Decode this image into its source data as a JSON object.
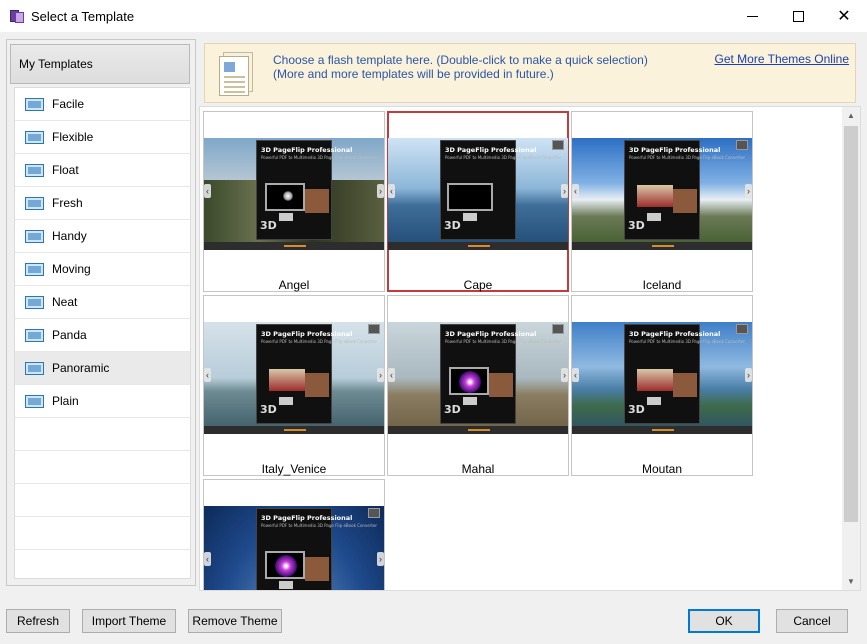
{
  "window": {
    "title": "Select a Template"
  },
  "left_panel": {
    "header": "My Templates",
    "items": [
      {
        "label": "Facile"
      },
      {
        "label": "Flexible"
      },
      {
        "label": "Float"
      },
      {
        "label": "Fresh"
      },
      {
        "label": "Handy"
      },
      {
        "label": "Moving"
      },
      {
        "label": "Neat"
      },
      {
        "label": "Panda"
      },
      {
        "label": "Panoramic",
        "selected": true
      },
      {
        "label": "Plain"
      }
    ]
  },
  "banner": {
    "line1": "Choose a flash template here. (Double-click to make a quick selection)",
    "line2": "(More and more templates will be provided in future.)",
    "link": "Get More Themes Online"
  },
  "thumbnail_text": {
    "brand": "3D PageFlip Professional",
    "tagline": "Powerful PDF to Multimedia 3D Page Flip eBook Converter",
    "badge": "3D"
  },
  "templates": [
    {
      "name": "Angel",
      "selected": false
    },
    {
      "name": "Cape",
      "selected": true
    },
    {
      "name": "Iceland",
      "selected": false
    },
    {
      "name": "Italy_Venice",
      "selected": false
    },
    {
      "name": "Mahal",
      "selected": false
    },
    {
      "name": "Moutan",
      "selected": false
    },
    {
      "name": "",
      "selected": false
    }
  ],
  "buttons": {
    "refresh": "Refresh",
    "import_theme": "Import Theme",
    "remove_theme": "Remove Theme",
    "ok": "OK",
    "cancel": "Cancel"
  },
  "colors": {
    "selection_border": "#c53a3a",
    "banner_bg": "#fbf2dc",
    "banner_text": "#2a55a6",
    "link": "#1a3fb0",
    "primary_button_border": "#0078d7"
  }
}
